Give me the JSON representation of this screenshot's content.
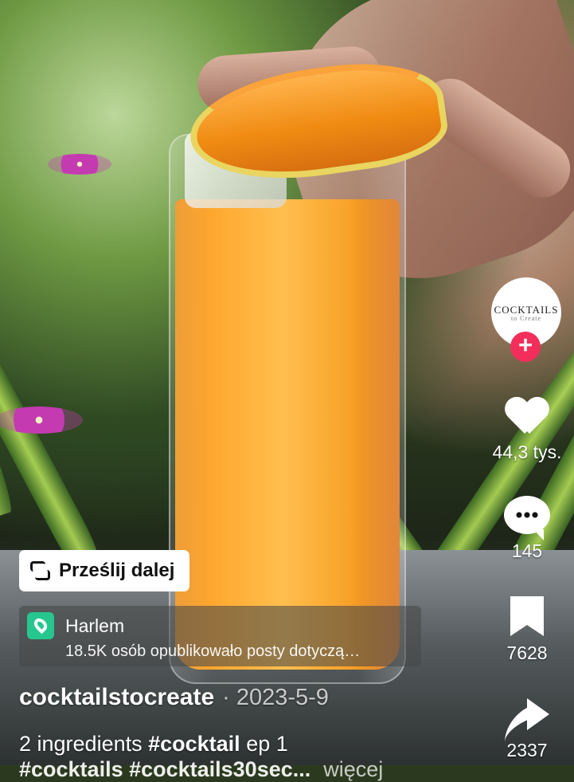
{
  "post": {
    "share_button_label": "Prześlij dalej",
    "location_title": "Harlem",
    "location_subtitle": "18.5K osób opublikowało posty dotyczą…",
    "author": "cocktailstocreate",
    "date": "· 2023-5-9",
    "caption_text_1": "2 ingredients ",
    "caption_tag_1": "#cocktail",
    "caption_text_2": " ep 1",
    "caption_line_2": "#cocktails #cocktails30sec...",
    "caption_more": "więcej"
  },
  "sidebar": {
    "avatar_title": "COCKTAILS",
    "avatar_subtitle": "to Create",
    "follow_label": "+",
    "likes": "44,3 tys.",
    "comments": "145",
    "saves": "7628",
    "shares": "2337"
  },
  "icons": {
    "share": "share-icon",
    "location": "location-pin-icon",
    "like": "heart-icon",
    "comment": "comment-icon",
    "save": "bookmark-icon",
    "forward": "share-arrow-icon"
  },
  "colors": {
    "follow": "#f12f5a",
    "location_icon": "#26c68f",
    "juice": "#ffa526"
  }
}
